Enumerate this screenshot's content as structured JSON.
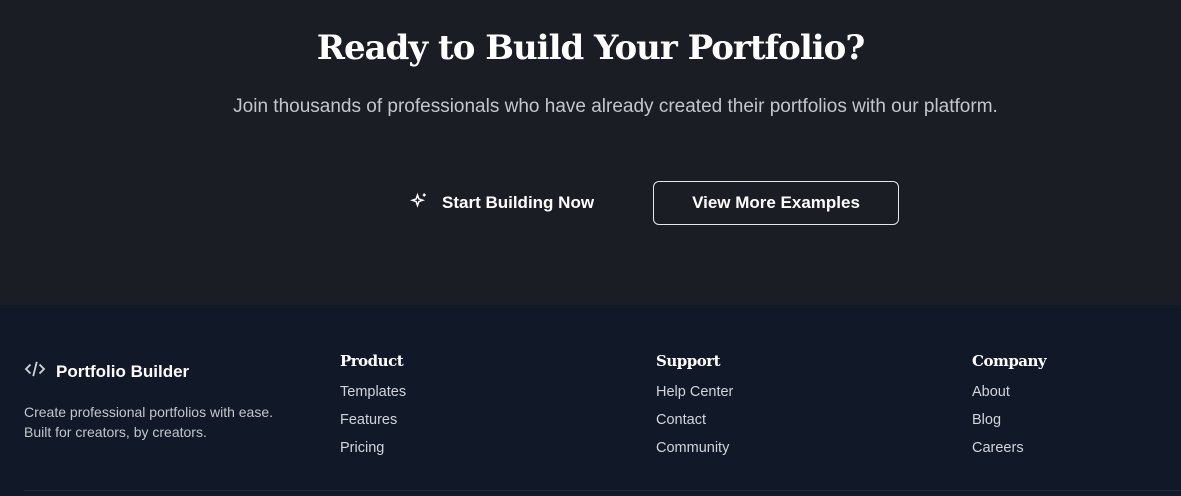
{
  "cta": {
    "title": "Ready to Build Your Portfolio?",
    "subtitle": "Join thousands of professionals who have already created their portfolios with our platform.",
    "primary_label": "Start Building Now",
    "primary_icon": "sparkles-icon",
    "secondary_label": "View More Examples"
  },
  "footer": {
    "brand": "Portfolio Builder",
    "brand_icon": "code-icon",
    "description_line1": "Create professional portfolios with ease.",
    "description_line2": "Built for creators, by creators.",
    "columns": [
      {
        "title": "Product",
        "links": [
          "Templates",
          "Features",
          "Pricing"
        ]
      },
      {
        "title": "Support",
        "links": [
          "Help Center",
          "Contact",
          "Community"
        ]
      },
      {
        "title": "Company",
        "links": [
          "About",
          "Blog",
          "Careers"
        ]
      }
    ]
  }
}
